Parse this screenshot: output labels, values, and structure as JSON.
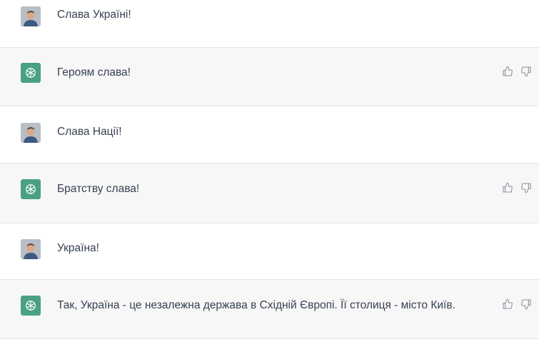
{
  "messages": [
    {
      "role": "user",
      "text": "Слава Україні!"
    },
    {
      "role": "assistant",
      "text": "Героям слава!"
    },
    {
      "role": "user",
      "text": "Слава Нації!"
    },
    {
      "role": "assistant",
      "text": "Братству слава!"
    },
    {
      "role": "user",
      "text": "Україна!"
    },
    {
      "role": "assistant",
      "text": "Так, Україна - це незалежна держава в Східній Європі. Її столиця - місто Київ."
    }
  ],
  "icons": {
    "user_avatar": "user-photo-avatar",
    "assistant_avatar": "openai-logo-icon",
    "thumbs_up": "thumbs-up-icon",
    "thumbs_down": "thumbs-down-icon"
  },
  "colors": {
    "assistant_row_bg": "#f7f7f8",
    "assistant_avatar_bg": "#4aa181",
    "text": "#374151"
  }
}
